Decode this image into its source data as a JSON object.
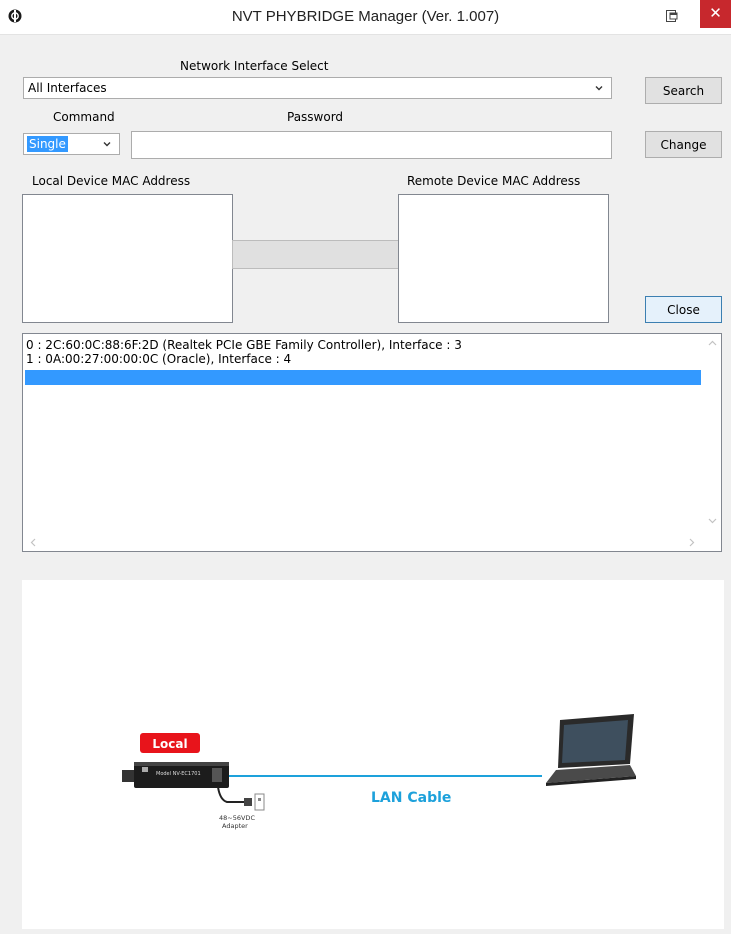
{
  "window": {
    "title": "NVT PHYBRIDGE Manager (Ver. 1.007)",
    "close_glyph": "✕"
  },
  "network": {
    "label": "Network Interface Select",
    "selected": "All Interfaces"
  },
  "command": {
    "label": "Command",
    "selected": "Single"
  },
  "password": {
    "label": "Password",
    "value": ""
  },
  "buttons": {
    "search": "Search",
    "change": "Change",
    "close": "Close"
  },
  "local_mac": {
    "label": "Local Device MAC Address"
  },
  "remote_mac": {
    "label": "Remote Device MAC Address"
  },
  "log": {
    "lines": [
      "0 : 2C:60:0C:88:6F:2D (Realtek PCIe GBE Family Controller), Interface : 3",
      "1 : 0A:00:27:00:00:0C (Oracle), Interface : 4"
    ]
  },
  "diagram": {
    "local_label": "Local",
    "cable_label": "LAN Cable",
    "adapter_line1": "48~56VDC",
    "adapter_line2": "Adapter",
    "device_text": "Model NV-EC1701",
    "local_color": "#e8141b",
    "cable_color": "#1da1db"
  },
  "icons": {
    "app": "app-logo-icon",
    "restore": "window-restore-icon",
    "dropdown": "chevron-down-icon"
  }
}
